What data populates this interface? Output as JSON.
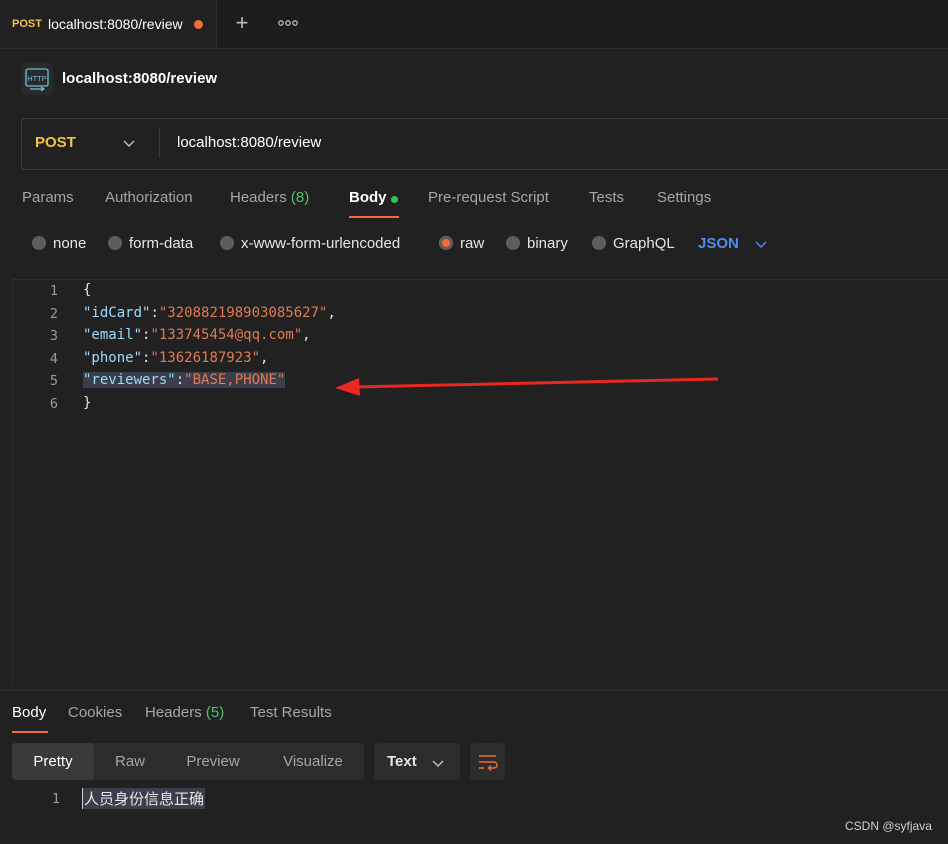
{
  "tab": {
    "method": "POST",
    "title": "localhost:8080/review"
  },
  "request": {
    "name": "localhost:8080/review",
    "method": "POST",
    "url": "localhost:8080/review"
  },
  "request_tabs": [
    {
      "label": "Params"
    },
    {
      "label": "Authorization"
    },
    {
      "label": "Headers",
      "count": "(8)"
    },
    {
      "label": "Body"
    },
    {
      "label": "Pre-request Script"
    },
    {
      "label": "Tests"
    },
    {
      "label": "Settings"
    }
  ],
  "body_types": [
    "none",
    "form-data",
    "x-www-form-urlencoded",
    "raw",
    "binary",
    "GraphQL"
  ],
  "body_type_selected": "raw",
  "language": "JSON",
  "editor": {
    "line_numbers": [
      "1",
      "2",
      "3",
      "4",
      "5",
      "6"
    ],
    "open_brace": "{",
    "close_brace": "}",
    "fields": [
      {
        "key": "\"idCard\"",
        "value": "\"320882198903085627\"",
        "sep": ":",
        "end": ","
      },
      {
        "key": "\"email\"",
        "value": "\"133745454@qq.com\"",
        "sep": ":",
        "end": ","
      },
      {
        "key": "\"phone\"",
        "value": "\"13626187923\"",
        "sep": ":",
        "end": ","
      },
      {
        "key": "\"reviewers\"",
        "value": "\"BASE,PHONE\"",
        "sep": ":",
        "end": ""
      }
    ]
  },
  "annotation_color": "#e8281f",
  "response": {
    "tabs": [
      {
        "label": "Body"
      },
      {
        "label": "Cookies"
      },
      {
        "label": "Headers",
        "count": "(5)"
      },
      {
        "label": "Test Results"
      }
    ],
    "views": [
      "Pretty",
      "Raw",
      "Preview",
      "Visualize"
    ],
    "format": "Text",
    "line_number": "1",
    "content": "人员身份信息正确"
  },
  "watermark": "CSDN @syfjava"
}
